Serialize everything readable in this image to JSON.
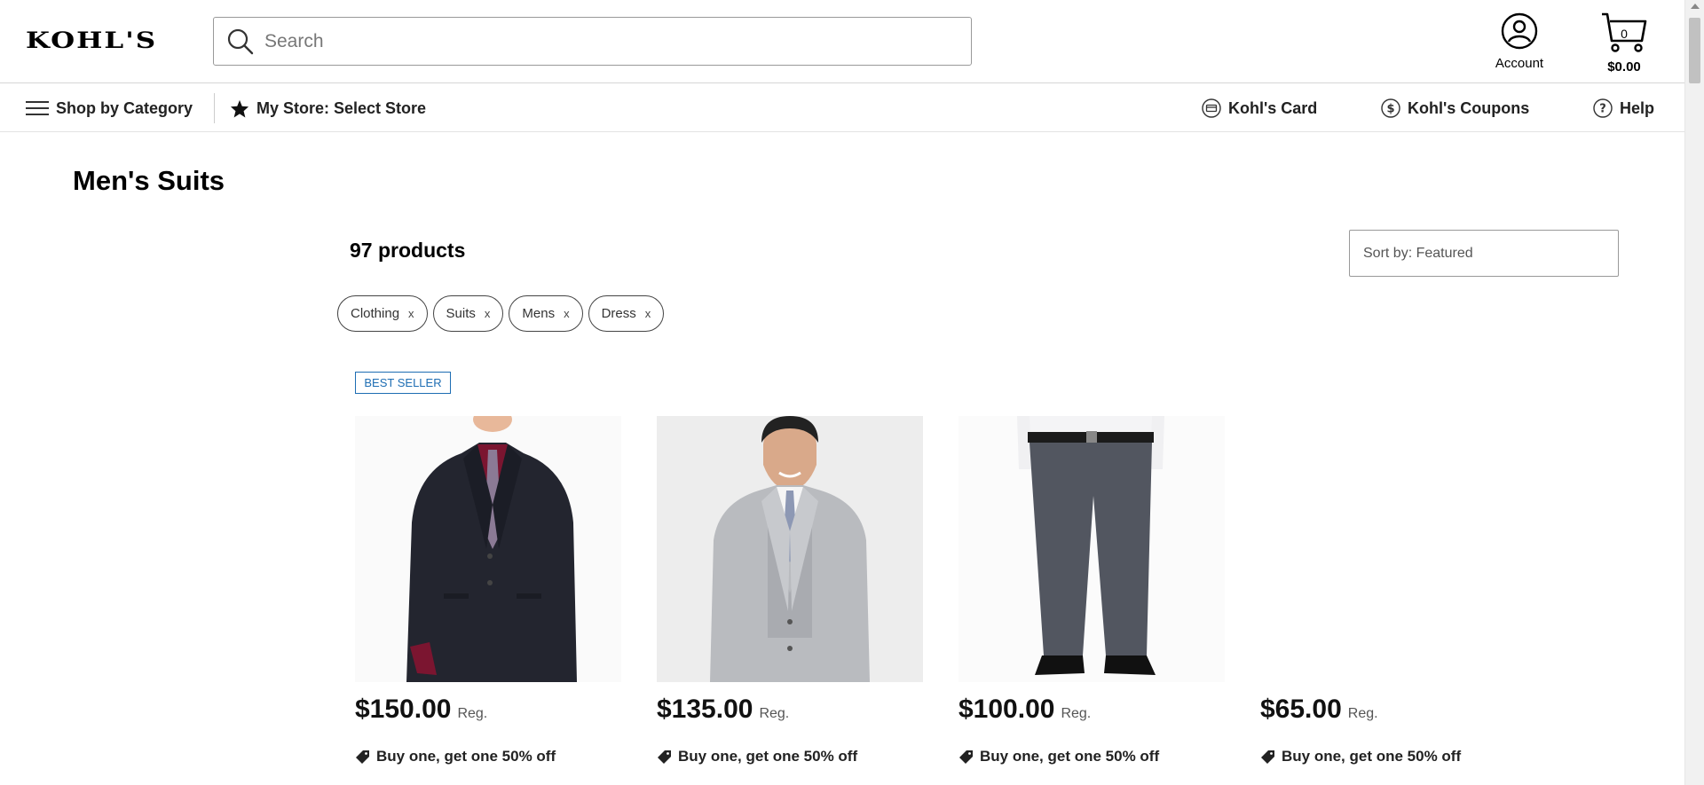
{
  "header": {
    "logo": "KOHL'S",
    "search_placeholder": "Search",
    "account_label": "Account",
    "cart_count": "0",
    "cart_total": "$0.00"
  },
  "nav": {
    "shop_by_category": "Shop by Category",
    "my_store": "My Store: Select Store",
    "kohls_card": "Kohl's Card",
    "kohls_coupons": "Kohl's Coupons",
    "help": "Help"
  },
  "page": {
    "title": "Men's Suits",
    "product_count": "97 products",
    "sort_label": "Sort by: Featured",
    "filters": [
      {
        "label": "Clothing",
        "remove": "x"
      },
      {
        "label": "Suits",
        "remove": "x"
      },
      {
        "label": "Mens",
        "remove": "x"
      },
      {
        "label": "Dress",
        "remove": "x"
      }
    ],
    "badge": "BEST SELLER"
  },
  "products": [
    {
      "price": "$150.00",
      "reg": "Reg.",
      "promo": "Buy one, get one 50% off",
      "image": "navy-suit-jacket"
    },
    {
      "price": "$135.00",
      "reg": "Reg.",
      "promo": "Buy one, get one 50% off",
      "image": "gray-three-piece-suit"
    },
    {
      "price": "$100.00",
      "reg": "Reg.",
      "promo": "Buy one, get one 50% off",
      "image": "charcoal-dress-pants"
    },
    {
      "price": "$65.00",
      "reg": "Reg.",
      "promo": "Buy one, get one 50% off",
      "image": ""
    }
  ],
  "colors": {
    "accent_blue": "#1d6db3",
    "text": "#222222",
    "border": "#999999"
  }
}
